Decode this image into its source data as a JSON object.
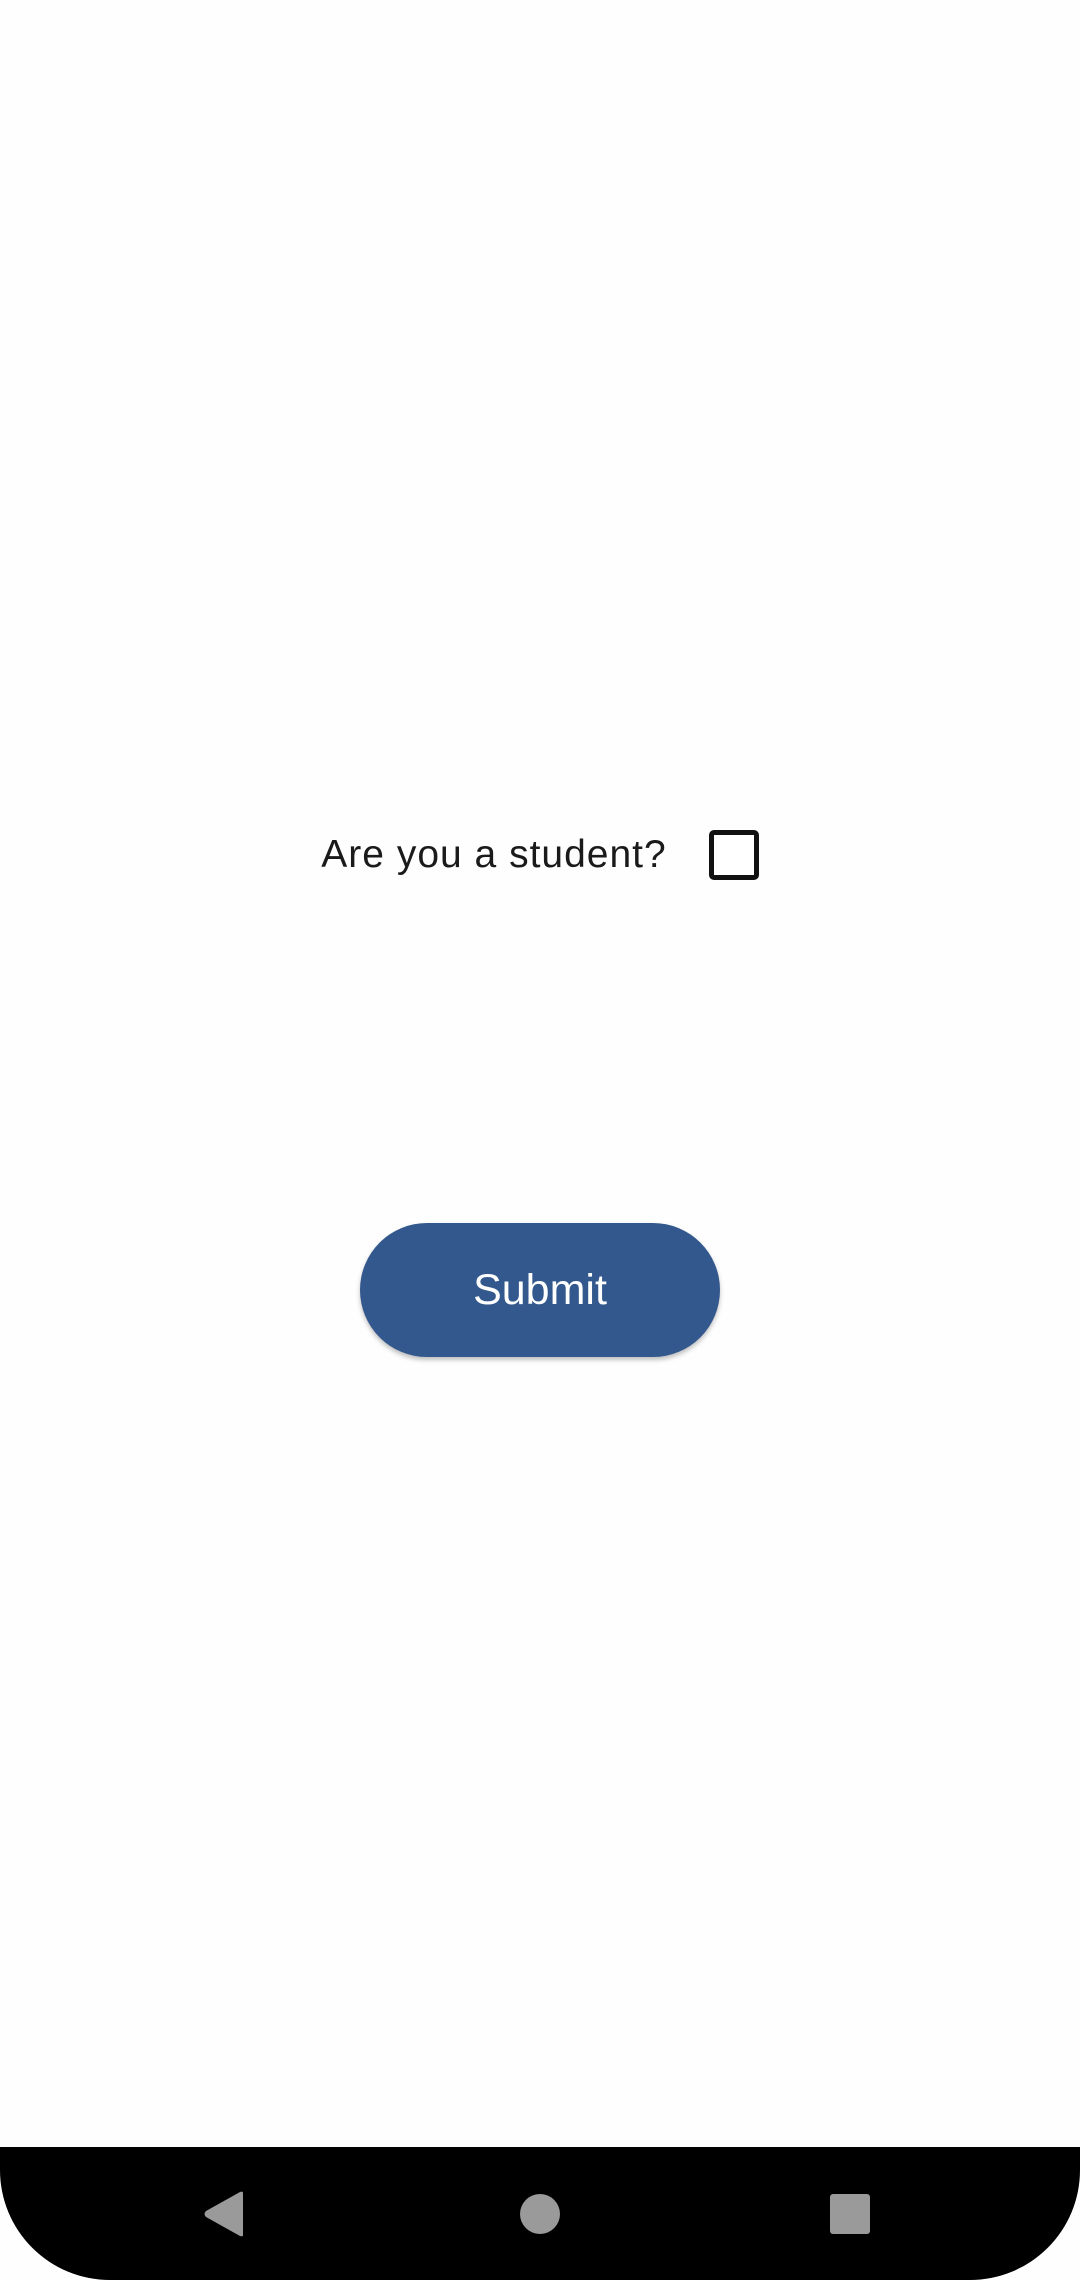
{
  "form": {
    "question_label": "Are you a student?",
    "checkbox_checked": false
  },
  "submit_button": {
    "label": "Submit",
    "color": "#33588d"
  },
  "nav_bar": {
    "icons": [
      "back-icon",
      "home-icon",
      "recents-icon"
    ],
    "icon_color": "#9a9a9a"
  }
}
